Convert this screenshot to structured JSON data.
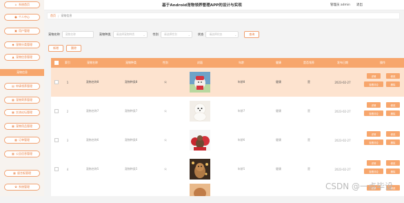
{
  "header": {
    "title": "基于Android宠物领养管理APP的设计与实现",
    "user": "管理员 admin",
    "logout": "退出"
  },
  "sidebar": {
    "items": [
      {
        "label": "系统首页",
        "icon": "home-icon",
        "active": false
      },
      {
        "label": "个人中心",
        "icon": "user-icon",
        "active": false
      },
      {
        "label": "用户管理",
        "icon": "users-icon",
        "active": false
      },
      {
        "label": "宠物分类管理",
        "icon": "tag-icon",
        "active": false
      },
      {
        "label": "宠物信息管理",
        "icon": "paw-icon",
        "active": false
      },
      {
        "label": "宠物信息",
        "icon": "",
        "active": true
      },
      {
        "label": "申请领养管理",
        "icon": "form-icon",
        "active": false
      },
      {
        "label": "宠物寄养管理",
        "icon": "grid-icon",
        "active": false
      },
      {
        "label": "交流论坛管理",
        "icon": "grid-icon",
        "active": false
      },
      {
        "label": "宠物用品管理",
        "icon": "grid-icon",
        "active": false
      },
      {
        "label": "订单管理",
        "icon": "grid-icon",
        "active": false
      },
      {
        "label": "公告信息管理",
        "icon": "grid-icon",
        "active": false
      },
      {
        "label": "留言板管理",
        "icon": "grid-icon",
        "active": false
      },
      {
        "label": "系统管理",
        "icon": "settings-icon",
        "active": false
      }
    ]
  },
  "breadcrumb": {
    "home": "首页",
    "current": "宠物信息"
  },
  "search": {
    "name_label": "宠物名称",
    "name_placeholder": "宠物名称",
    "type_label": "宠物种类",
    "type_placeholder": "请选择宠物种类",
    "gender_label": "性别",
    "gender_placeholder": "请选择性别",
    "status_label": "状态",
    "status_placeholder": "请选择状态",
    "button": "查询"
  },
  "actions": {
    "add": "新增",
    "delete": "删除"
  },
  "table": {
    "columns": [
      "索引",
      "宠物名称",
      "宠物种类",
      "性别",
      "封面",
      "年龄",
      "健康",
      "是否领养",
      "发布日期",
      "操作"
    ],
    "rows": [
      {
        "index": "1",
        "name": "宠物名称8",
        "type": "宠物种类8",
        "gender": "公",
        "age": "年龄8",
        "health": "健康",
        "adopted": "是",
        "date": "2023-02-27",
        "highlight": true
      },
      {
        "index": "2",
        "name": "宠物名称7",
        "type": "宠物种类7",
        "gender": "公",
        "age": "年龄7",
        "health": "健康",
        "adopted": "是",
        "date": "2023-02-27",
        "highlight": false
      },
      {
        "index": "3",
        "name": "宠物名称6",
        "type": "宠物种类6",
        "gender": "公",
        "age": "年龄6",
        "health": "健康",
        "adopted": "是",
        "date": "2023-02-27",
        "highlight": false
      },
      {
        "index": "4",
        "name": "宠物名称5",
        "type": "宠物种类5",
        "gender": "公",
        "age": "年龄5",
        "health": "健康",
        "adopted": "是",
        "date": "2023-02-27",
        "highlight": false
      }
    ],
    "ops": {
      "detail": "详情",
      "edit": "修改",
      "review": "查看评论",
      "delete": "删除"
    }
  },
  "watermark": "CSDN @一点毕设",
  "colors": {
    "accent": "#f7a66c",
    "accent_text": "#e87c3e",
    "row_highlight": "#fde3cf"
  }
}
